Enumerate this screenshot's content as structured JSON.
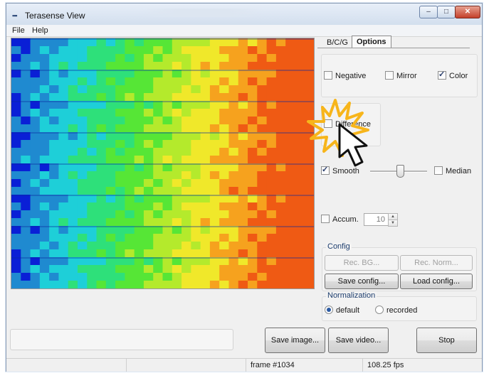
{
  "window": {
    "title": "Terasense View",
    "controls": {
      "minimize": "–",
      "maximize": "□",
      "close": "✕"
    }
  },
  "menu": [
    "File",
    "Help"
  ],
  "tabs": {
    "bcg": "B/C/G",
    "options": "Options",
    "active": "Options"
  },
  "options": {
    "negative": {
      "label": "Negative",
      "checked": false
    },
    "mirror": {
      "label": "Mirror",
      "checked": false
    },
    "color": {
      "label": "Color",
      "checked": true
    },
    "difference": {
      "label": "Difference",
      "checked": false
    },
    "smooth": {
      "label": "Smooth",
      "checked": true
    },
    "median": {
      "label": "Median",
      "checked": false
    },
    "smooth_level": 0.55,
    "accum": {
      "label": "Accum.",
      "checked": false,
      "value": "10"
    }
  },
  "config": {
    "legend": "Config",
    "rec_bg": "Rec. BG...",
    "rec_norm": "Rec. Norm...",
    "save_config": "Save config...",
    "load_config": "Load config..."
  },
  "normalization": {
    "legend": "Normalization",
    "default": "default",
    "recorded": "recorded",
    "selected": "default"
  },
  "actions": {
    "save_image": "Save image...",
    "save_video": "Save video...",
    "stop": "Stop"
  },
  "status": {
    "frame": "frame #1034",
    "fps": "108.25 fps"
  },
  "heatmap": {
    "grid_cols": 32,
    "bands": 8,
    "colormap": [
      "#0a1fd6",
      "#1f8ad0",
      "#1ecfd8",
      "#2ee07a",
      "#56e636",
      "#b4ea2c",
      "#f0e82a",
      "#f6a21e",
      "#ef5a14"
    ]
  },
  "cursor_icon": "mouse-pointer-icon",
  "click_effect_color": "#f7b51b"
}
